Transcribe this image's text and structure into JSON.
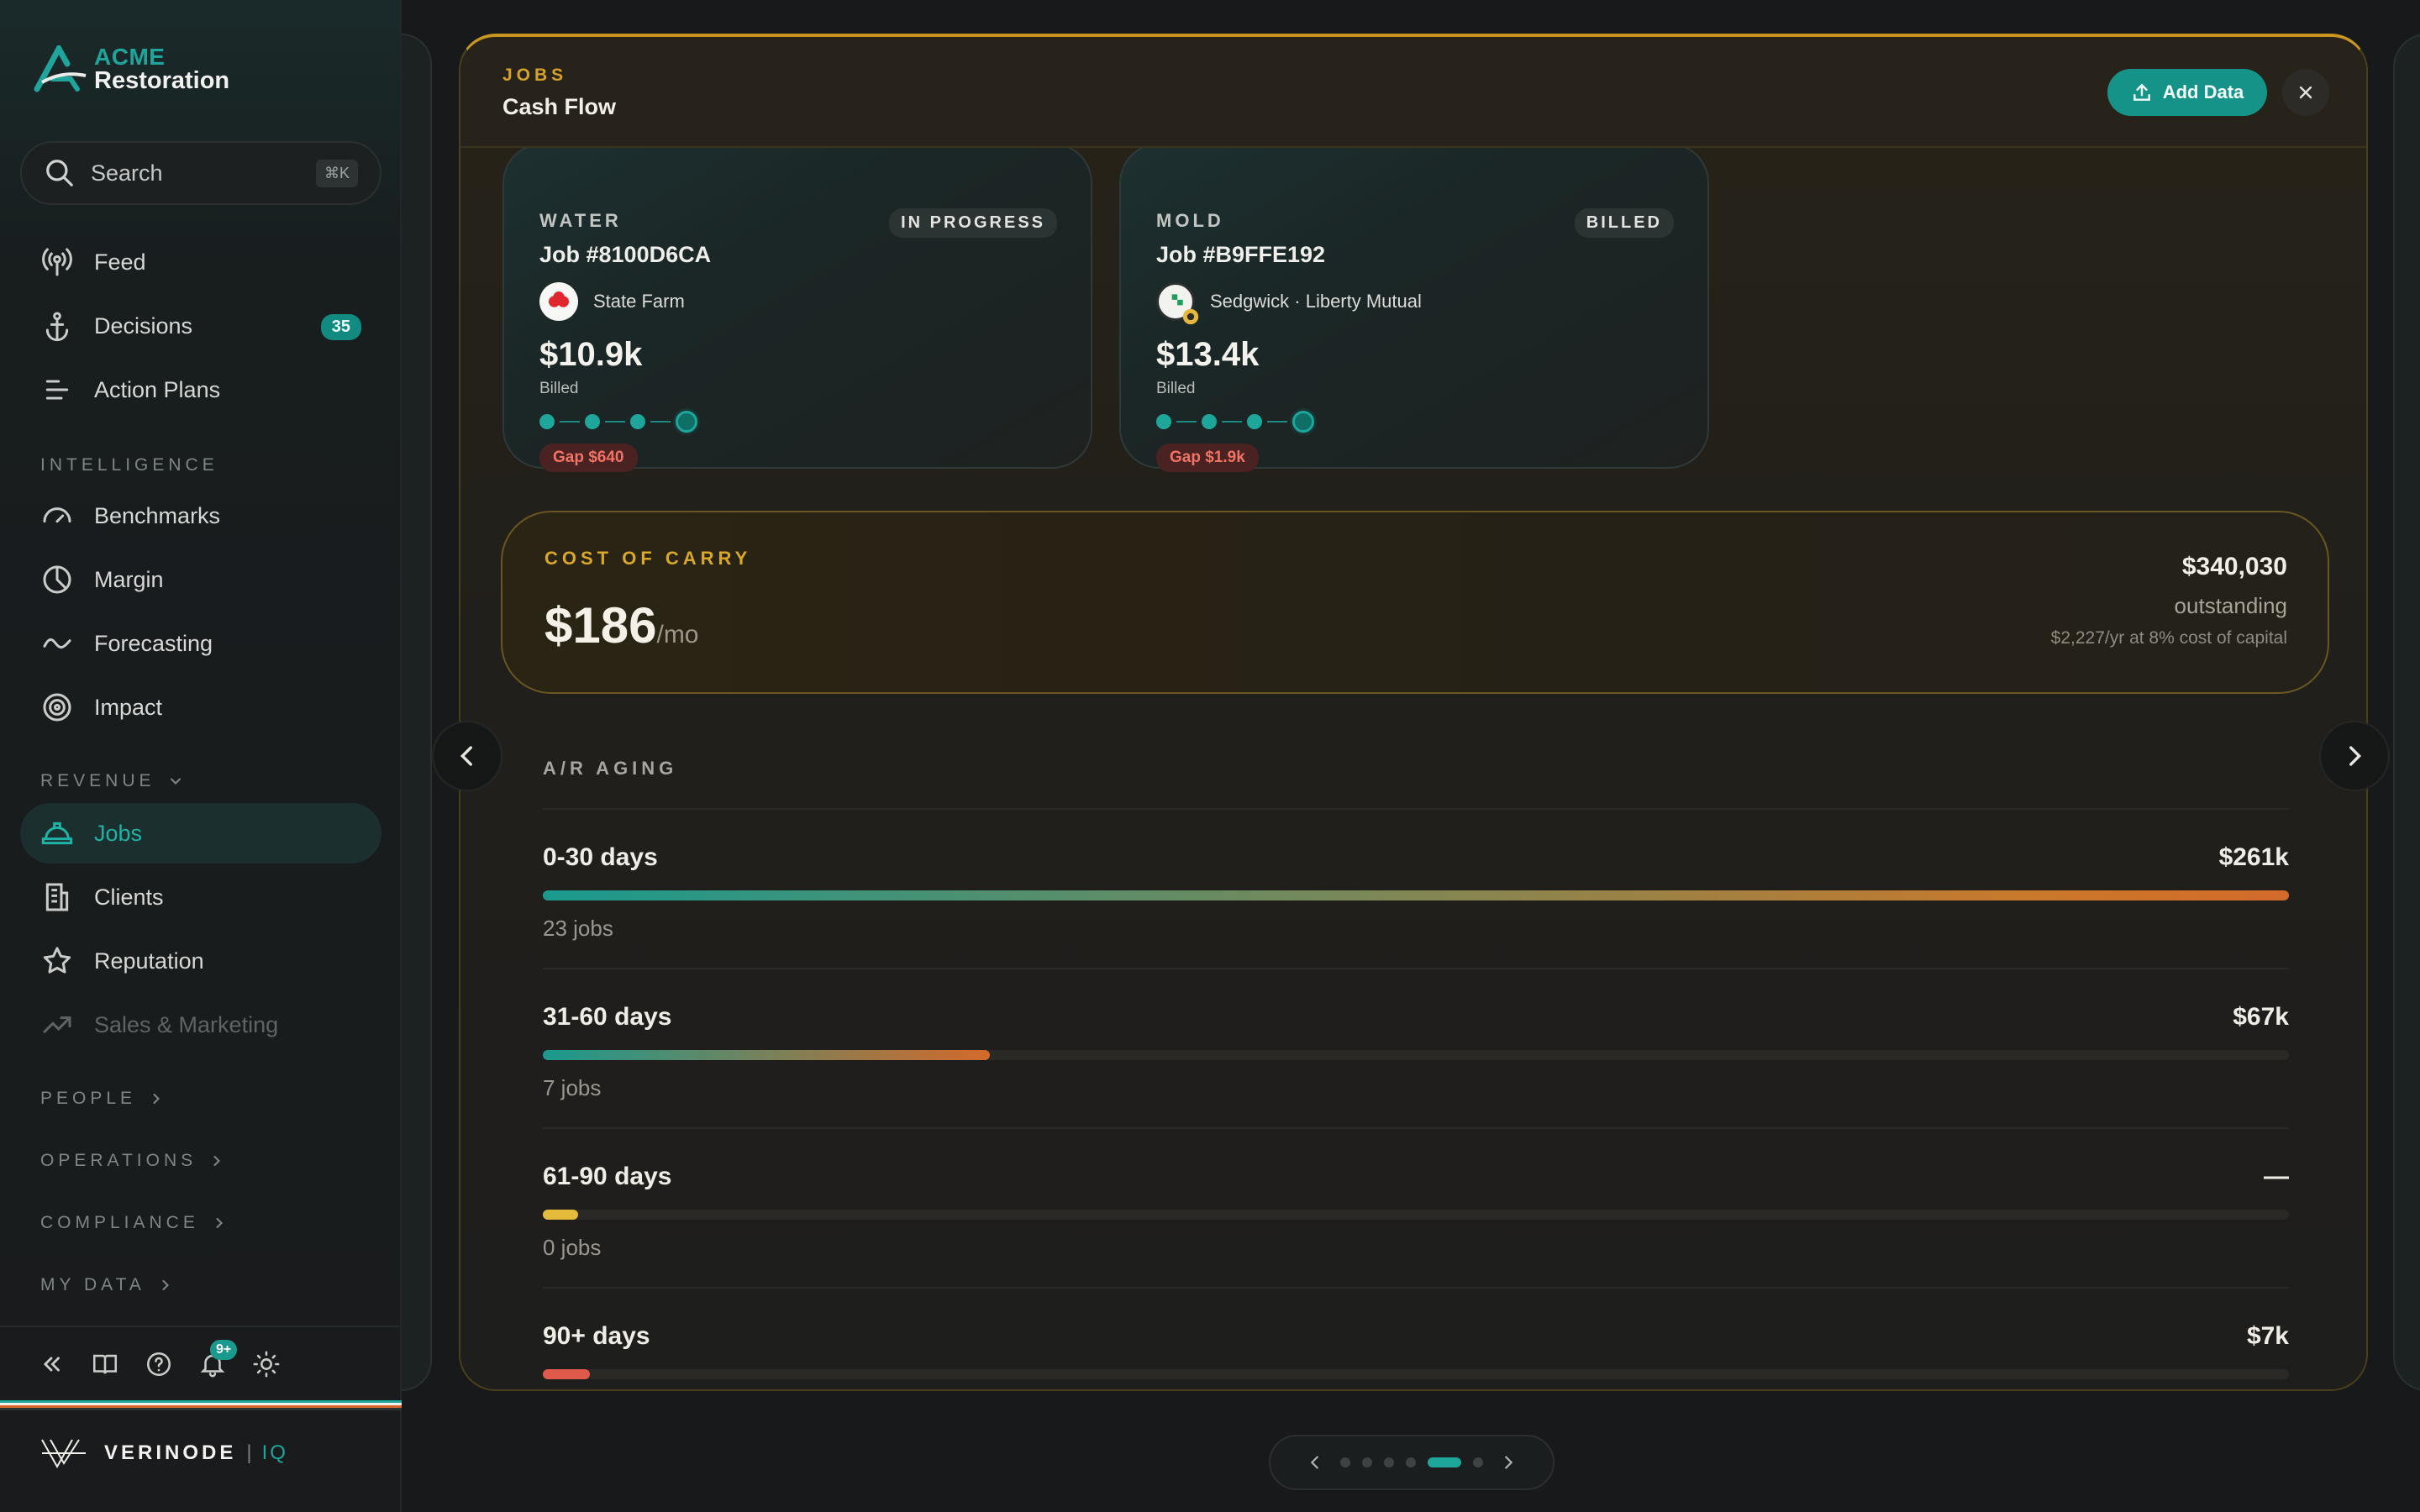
{
  "brand": {
    "line1": "ACME",
    "line2": "Restoration",
    "accent": "#1fa59b"
  },
  "search": {
    "placeholder": "Search",
    "shortcut": "⌘K"
  },
  "nav": {
    "top": [
      {
        "label": "Feed",
        "icon": "broadcast-icon"
      },
      {
        "label": "Decisions",
        "icon": "anchor-icon",
        "badge": "35"
      },
      {
        "label": "Action Plans",
        "icon": "list-icon"
      }
    ],
    "intelligence_label": "INTELLIGENCE",
    "intelligence": [
      {
        "label": "Benchmarks",
        "icon": "gauge-icon"
      },
      {
        "label": "Margin",
        "icon": "pie-icon"
      },
      {
        "label": "Forecasting",
        "icon": "trend-icon"
      },
      {
        "label": "Impact",
        "icon": "target-icon"
      }
    ],
    "revenue_label": "REVENUE",
    "revenue": [
      {
        "label": "Jobs",
        "icon": "hardhat-icon",
        "active": true
      },
      {
        "label": "Clients",
        "icon": "building-icon"
      },
      {
        "label": "Reputation",
        "icon": "star-icon"
      },
      {
        "label": "Sales & Marketing",
        "icon": "chart-up-icon",
        "disabled": true
      }
    ],
    "collapsed_sections": [
      "PEOPLE",
      "OPERATIONS",
      "COMPLIANCE",
      "MY DATA"
    ]
  },
  "footer": {
    "notifications": "9+"
  },
  "vendor": {
    "name": "VERINODE",
    "sep": "|",
    "suffix": "IQ"
  },
  "card": {
    "crumb": "JOBS",
    "title": "Cash Flow",
    "add_button": "Add Data",
    "jobs": [
      {
        "type": "WATER",
        "status": "IN PROGRESS",
        "id": "Job #8100D6CA",
        "carrier": "State Farm",
        "amount": "$10.9k",
        "amount_label": "Billed",
        "gap": "Gap $640"
      },
      {
        "type": "MOLD",
        "status": "BILLED",
        "id": "Job #B9FFE192",
        "carrier": "Sedgwick · Liberty Mutual",
        "amount": "$13.4k",
        "amount_label": "Billed",
        "gap": "Gap $1.9k"
      }
    ],
    "cost_of_carry": {
      "label": "COST OF CARRY",
      "amount": "$186",
      "unit": "/mo",
      "outstanding": "$340,030",
      "outstanding_label": "outstanding",
      "note": "$2,227/yr at 8% cost of capital"
    },
    "aging": {
      "label": "A/R AGING",
      "buckets": [
        {
          "name": "0-30 days",
          "amount": "$261k",
          "jobs": "23 jobs",
          "share": 1.0
        },
        {
          "name": "31-60 days",
          "amount": "$67k",
          "jobs": "7 jobs",
          "share": 0.256
        },
        {
          "name": "61-90 days",
          "amount": "—",
          "jobs": "0 jobs",
          "share": 0.02
        },
        {
          "name": "90+ days",
          "amount": "$7k",
          "jobs": "",
          "share": 0.027
        }
      ]
    }
  },
  "pager": {
    "pages": 6,
    "current": 5
  },
  "colors": {
    "teal": "#1fa69a",
    "gold": "#d9a72a",
    "red": "#f07366"
  }
}
